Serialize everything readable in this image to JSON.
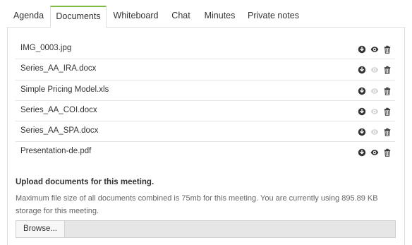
{
  "tabs": [
    {
      "label": "Agenda",
      "active": false
    },
    {
      "label": "Documents",
      "active": true
    },
    {
      "label": "Whiteboard",
      "active": false
    },
    {
      "label": "Chat",
      "active": false
    },
    {
      "label": "Minutes",
      "active": false
    },
    {
      "label": "Private notes",
      "active": false
    }
  ],
  "files": [
    {
      "name": "IMG_0003.jpg",
      "preview_enabled": true
    },
    {
      "name": "Series_AA_IRA.docx",
      "preview_enabled": false
    },
    {
      "name": "Simple Pricing Model.xls",
      "preview_enabled": false
    },
    {
      "name": "Series_AA_COI.docx",
      "preview_enabled": false
    },
    {
      "name": "Series_AA_SPA.docx",
      "preview_enabled": false
    },
    {
      "name": "Presentation-de.pdf",
      "preview_enabled": true
    }
  ],
  "icons": {
    "download": "download-icon",
    "preview": "eye-icon",
    "delete": "trash-icon"
  },
  "upload": {
    "title": "Upload documents for this meeting.",
    "description": "Maximum file size of all documents combined is 75mb for this meeting. You are currently using 895.89 KB storage for this meeting.",
    "browse_label": "Browse..."
  },
  "colors": {
    "active_tab_accent": "#7dbb43",
    "icon_active": "#333333",
    "icon_disabled": "#d5d5d5"
  }
}
